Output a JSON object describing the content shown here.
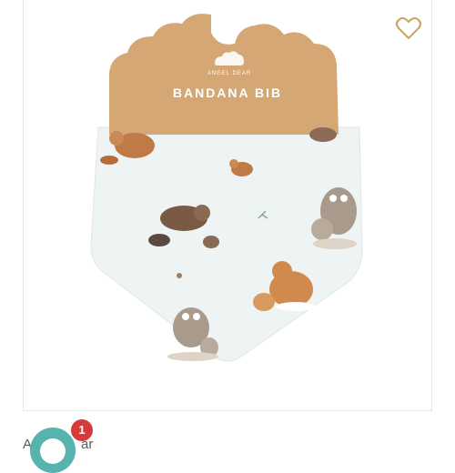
{
  "product": {
    "package_brand": "ANGEL DEAR",
    "package_title": "BANDANA BIB",
    "image_alt": "Bandana bib with woodland animal print"
  },
  "brand_row": {
    "text_left": "A",
    "text_right": "ar"
  },
  "cart_badge": {
    "count": "1"
  },
  "colors": {
    "accent": "#c9a262",
    "badge": "#d63a3a",
    "chat_button": "#57b3ad"
  },
  "icons": {
    "wishlist": "heart-outline-icon"
  }
}
